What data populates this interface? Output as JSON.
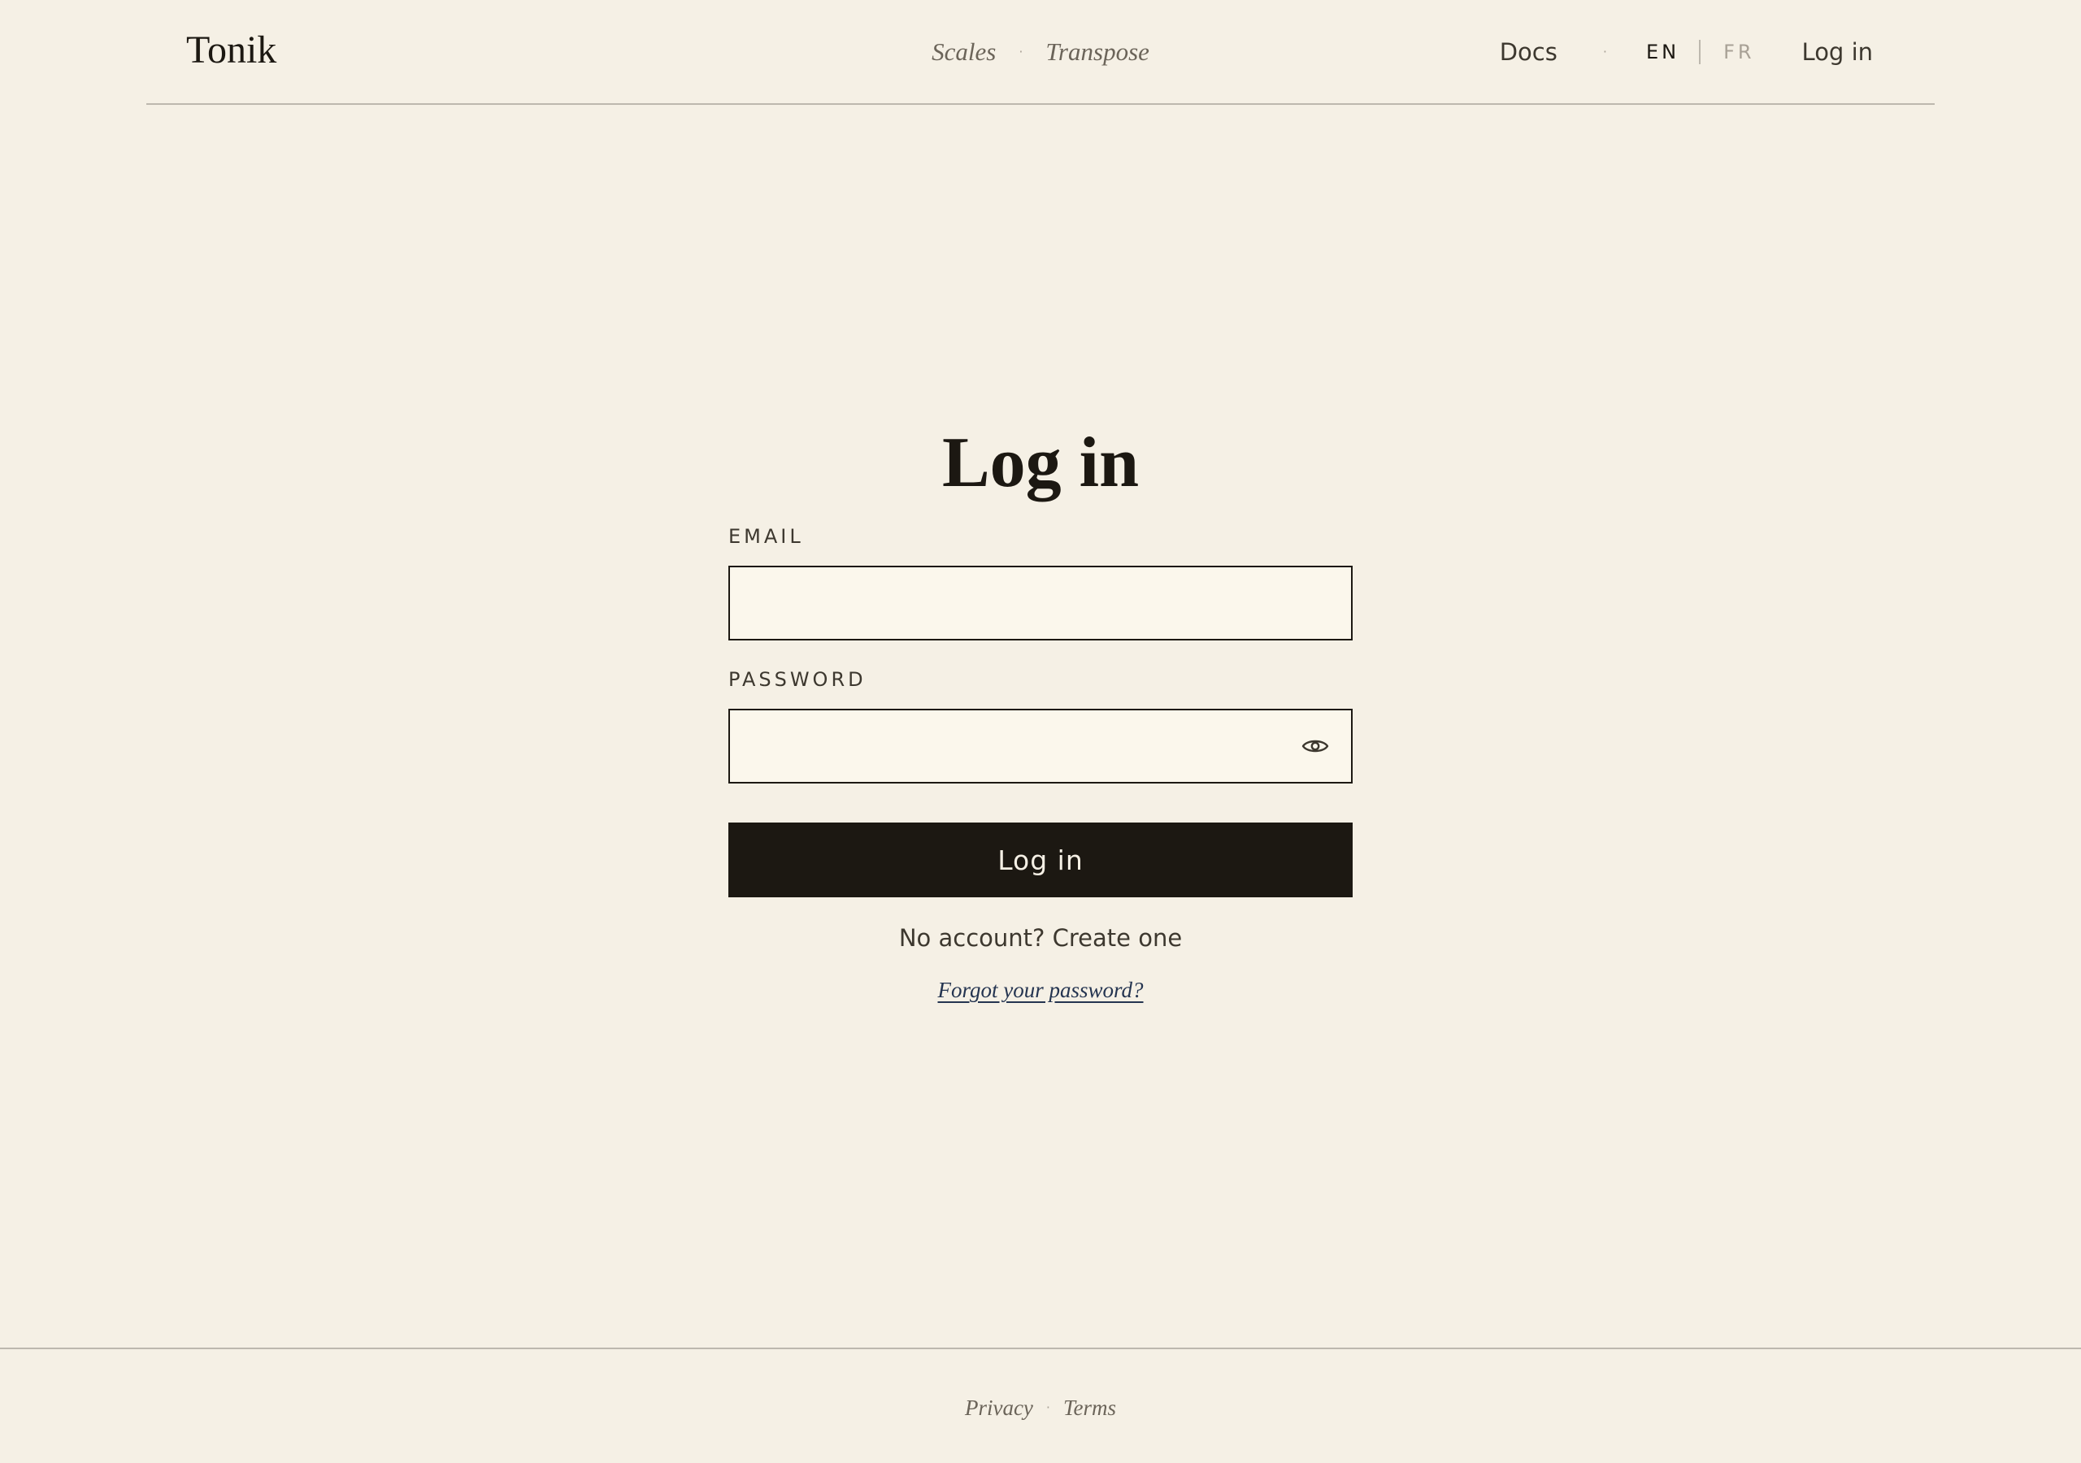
{
  "header": {
    "brand": "Tonik",
    "nav_center": [
      {
        "label": "Scales"
      },
      {
        "label": "Transpose"
      }
    ],
    "separator": "·",
    "docs_label": "Docs",
    "lang": {
      "en": "EN",
      "fr": "FR",
      "active": "EN"
    },
    "login_label": "Log in"
  },
  "form": {
    "title": "Log in",
    "email_label": "EMAIL",
    "email_value": "",
    "password_label": "PASSWORD",
    "password_value": "",
    "password_toggle_icon": "eye-icon",
    "submit_label": "Log in",
    "signup_text": "No account? Create one",
    "forgot_label": "Forgot your password?"
  },
  "footer": {
    "links": [
      {
        "label": "Privacy"
      },
      {
        "label": "Terms"
      }
    ],
    "separator": "·"
  },
  "colors": {
    "background": "#f5f0e5",
    "input_background": "#fbf7ec",
    "primary": "#1c1812",
    "muted": "#6b6459",
    "rule": "#bdb8ae",
    "link": "#243450"
  }
}
